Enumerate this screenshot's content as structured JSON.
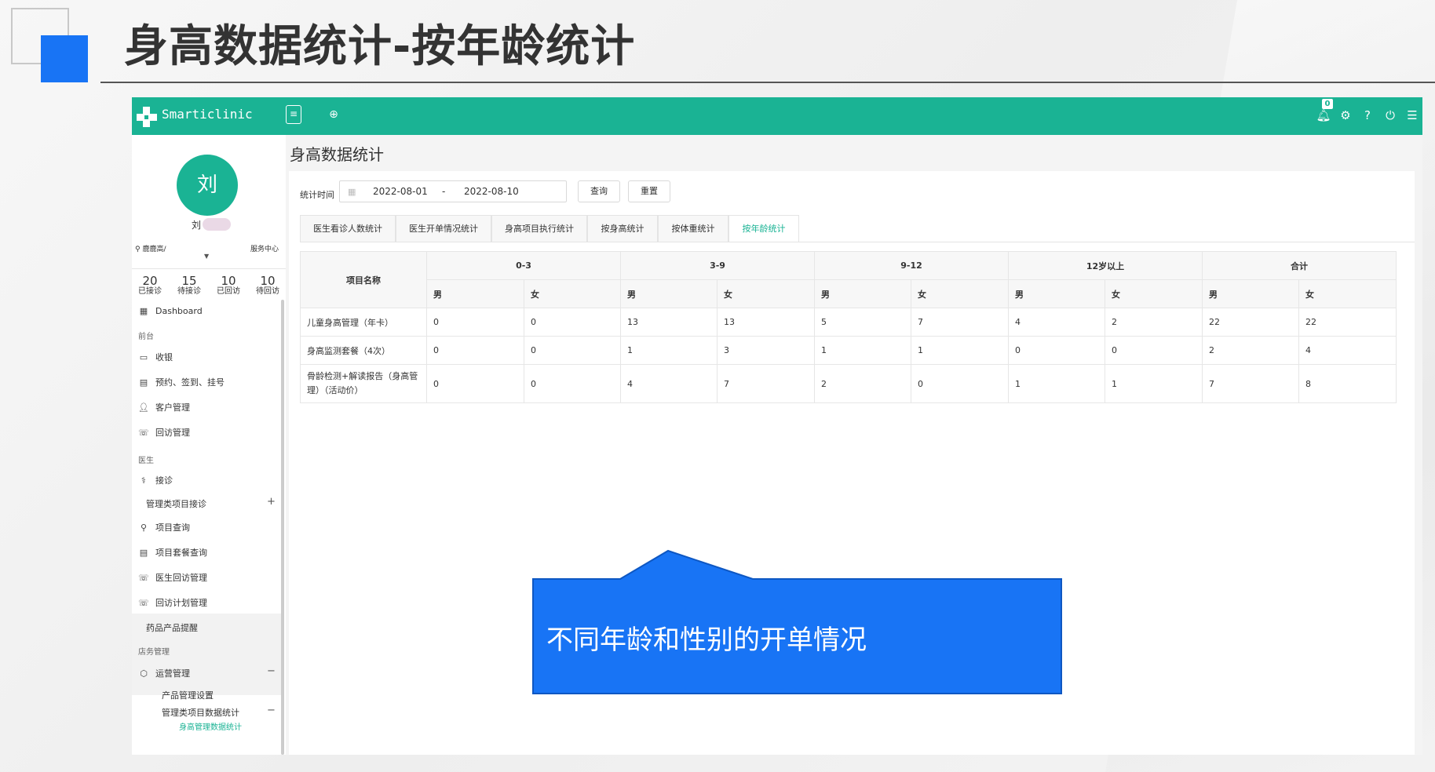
{
  "slide": {
    "title": "身高数据统计-按年龄统计"
  },
  "app": {
    "brand": "Smarticlinic",
    "notification_count": "0",
    "icons": {
      "logo": "cross-logo-icon",
      "menu_toggle": "menu-toggle-icon",
      "home": "compass-icon",
      "bell": "bell-icon",
      "settings": "gear-icon",
      "help": "help-circle-icon",
      "power": "power-icon",
      "list": "list-icon"
    },
    "accent_color": "#1ab394"
  },
  "sidebar": {
    "avatar_char": "刘",
    "user_name_initial": "刘",
    "location": "鹿鹿高/",
    "service_center": "服务中心",
    "stats": [
      {
        "num": "20",
        "label": "已接诊"
      },
      {
        "num": "15",
        "label": "待接诊"
      },
      {
        "num": "10",
        "label": "已回访"
      },
      {
        "num": "10",
        "label": "待回访"
      }
    ],
    "dashboard": "Dashboard",
    "group_front": "前台",
    "cashier": "收银",
    "appointment": "预约、签到、挂号",
    "customer": "客户管理",
    "followup": "回访管理",
    "group_doctor": "医生",
    "consult": "接诊",
    "mgmt_consult": "管理类项目接诊",
    "item_query": "项目查询",
    "package_query": "项目套餐查询",
    "doctor_followup": "医生回访管理",
    "followup_plan": "回访计划管理",
    "drug_reminder": "药品产品提醒",
    "group_store": "店务管理",
    "operation": "运营管理",
    "product_settings": "产品管理设置",
    "mgmt_stats": "管理类项目数据统计",
    "height_stats": "身高管理数据统计",
    "plus": "+",
    "minus": "−"
  },
  "main": {
    "page_title": "身高数据统计",
    "filter_label": "统计时间",
    "date_start": "2022-08-01",
    "date_sep": "-",
    "date_end": "2022-08-10",
    "query_button": "查询",
    "reset_button": "重置",
    "tabs": [
      {
        "label": "医生看诊人数统计"
      },
      {
        "label": "医生开单情况统计"
      },
      {
        "label": "身高项目执行统计"
      },
      {
        "label": "按身高统计"
      },
      {
        "label": "按体重统计"
      },
      {
        "label": "按年龄统计"
      }
    ],
    "active_tab_index": 5,
    "table": {
      "name_header": "项目名称",
      "age_groups": [
        "0-3",
        "3-9",
        "9-12",
        "12岁以上",
        "合计"
      ],
      "male": "男",
      "female": "女",
      "rows": [
        {
          "name": "儿童身高管理（年卡）",
          "values": [
            "0",
            "0",
            "13",
            "13",
            "5",
            "7",
            "4",
            "2",
            "22",
            "22"
          ]
        },
        {
          "name": "身高监测套餐（4次）",
          "values": [
            "0",
            "0",
            "1",
            "3",
            "1",
            "1",
            "0",
            "0",
            "2",
            "4"
          ]
        },
        {
          "name": "骨龄检测+解读报告（身高管理）（活动价）",
          "values": [
            "0",
            "0",
            "4",
            "7",
            "2",
            "0",
            "1",
            "1",
            "7",
            "8"
          ]
        }
      ]
    }
  },
  "callout": {
    "text": "不同年龄和性别的开单情况",
    "color": "#1874f5"
  }
}
